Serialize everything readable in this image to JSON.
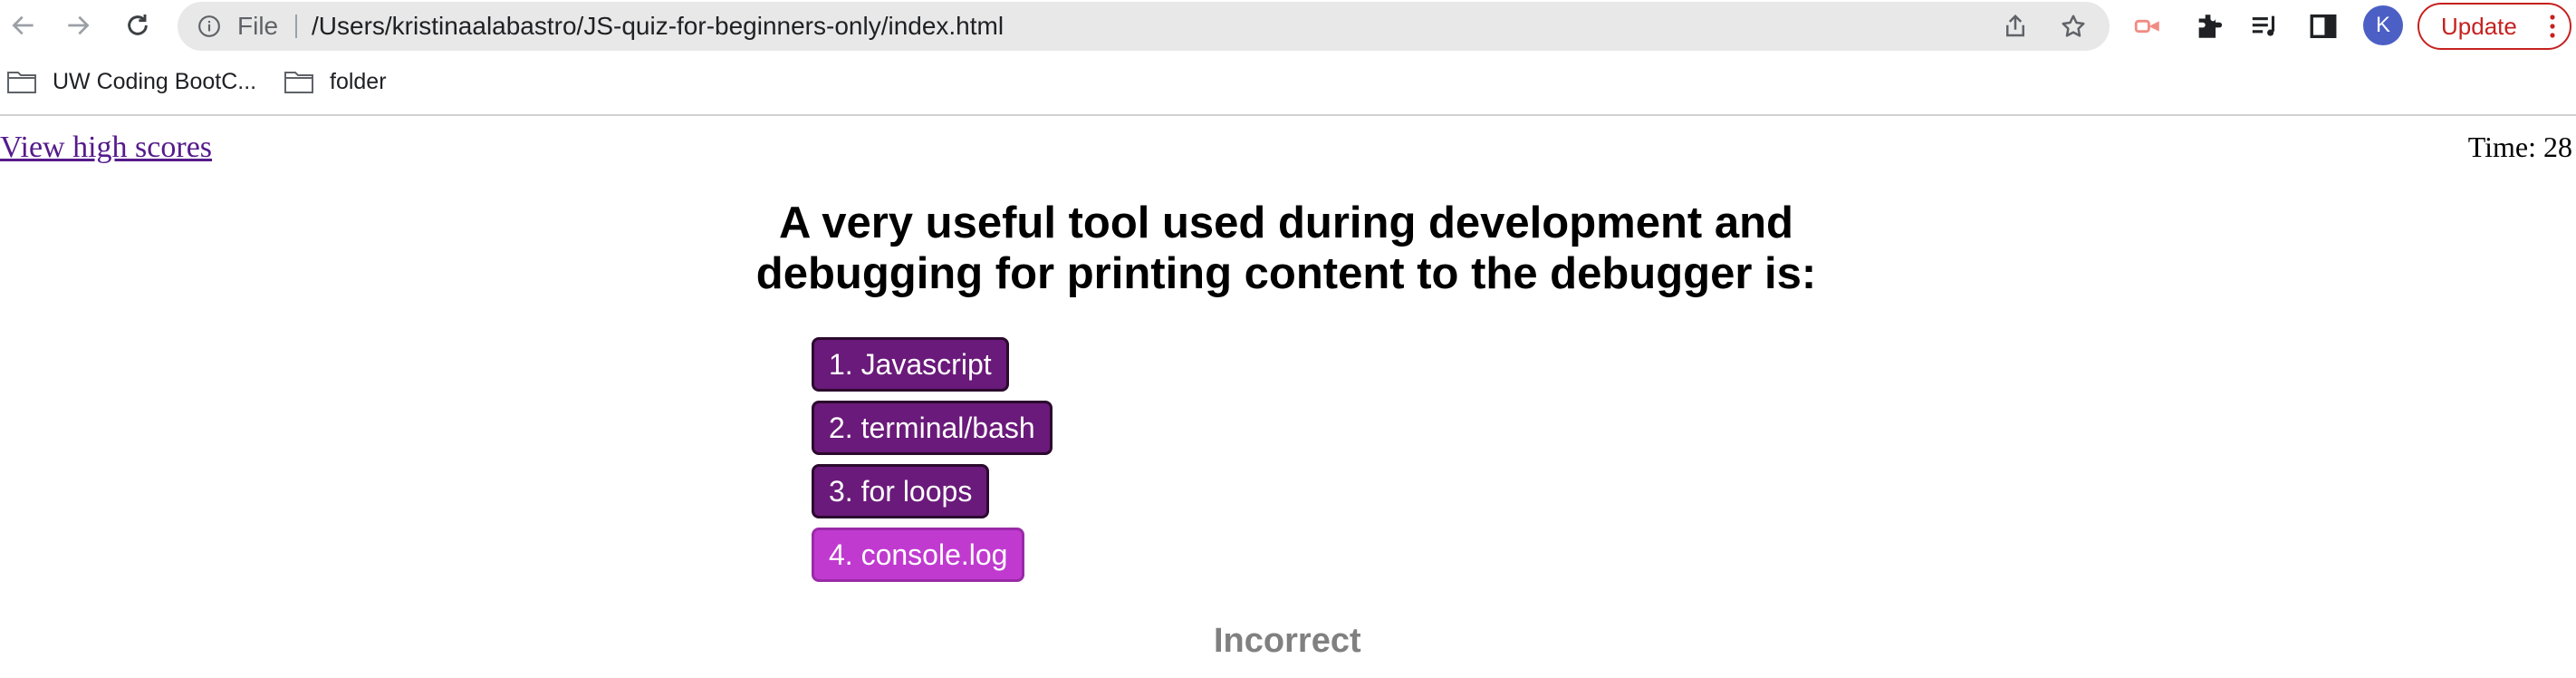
{
  "browser": {
    "omnibox": {
      "scheme_label": "File",
      "url": "/Users/kristinaalabastro/JS-quiz-for-beginners-only/index.html"
    },
    "avatar_letter": "K",
    "update_label": "Update",
    "icons": [
      "back-icon",
      "forward-icon",
      "reload-icon",
      "info-icon",
      "share-icon",
      "star-icon",
      "cast-icon",
      "extensions-icon",
      "reading-list-icon",
      "side-panel-icon",
      "more-icon"
    ],
    "colors": {
      "update_red": "#c5221f",
      "avatar_blue": "#4b5fc5"
    }
  },
  "bookmarks": [
    {
      "label": "UW Coding BootC..."
    },
    {
      "label": "folder"
    }
  ],
  "page": {
    "high_scores_link": "View high scores",
    "timer_text": "Time: 28",
    "question": "A very useful tool used during development and debugging for printing content to the debugger is:",
    "answers": [
      {
        "label": "1. Javascript",
        "selected": false
      },
      {
        "label": "2. terminal/bash",
        "selected": false
      },
      {
        "label": "3. for loops",
        "selected": false
      },
      {
        "label": "4. console.log",
        "selected": true
      }
    ],
    "feedback": "Incorrect",
    "colors": {
      "answer": "#6a1a7a",
      "answer_selected": "#c03ad0",
      "feedback": "#808080",
      "link": "#551a8b"
    }
  }
}
